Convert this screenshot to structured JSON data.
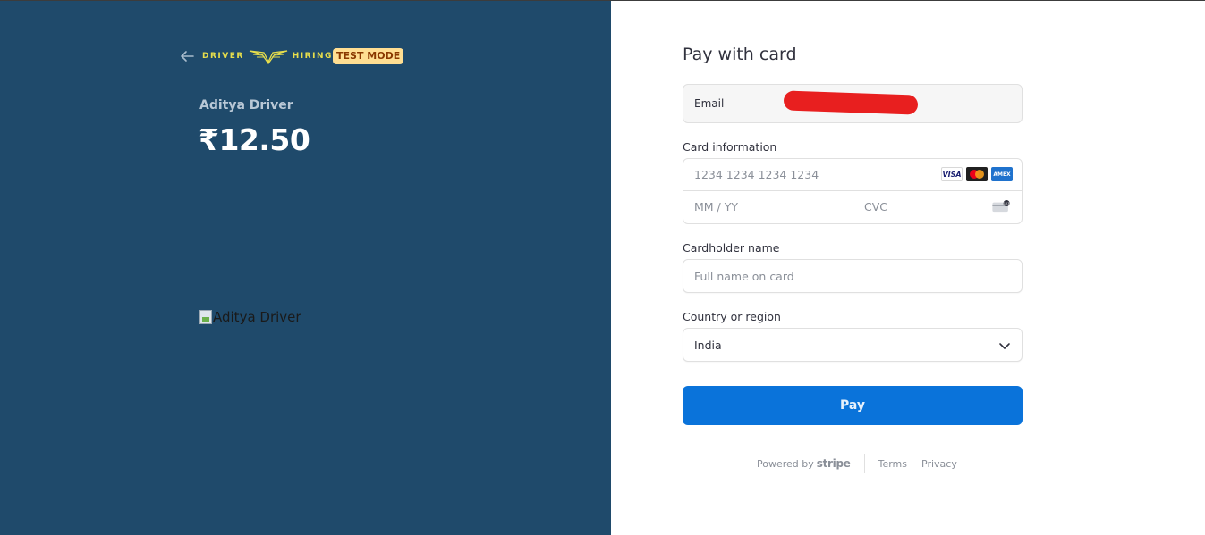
{
  "merchant": {
    "logo_left": "DRIVER",
    "logo_right": "HIRING",
    "test_badge": "TEST MODE",
    "brand_color": "#e7de4c"
  },
  "product": {
    "name": "Aditya Driver",
    "amount": "₹12.50",
    "image_alt": "Aditya Driver"
  },
  "checkout": {
    "title": "Pay with card",
    "email": {
      "label": "Email",
      "value": ""
    },
    "card_info": {
      "label": "Card information",
      "number_placeholder": "1234 1234 1234 1234",
      "expiry_placeholder": "MM / YY",
      "cvc_placeholder": "CVC",
      "brands": [
        "VISA",
        "mastercard",
        "AMEX"
      ]
    },
    "cardholder": {
      "label": "Cardholder name",
      "placeholder": "Full name on card"
    },
    "country": {
      "label": "Country or region",
      "selected": "India"
    },
    "pay_button": "Pay",
    "accent_color": "#0a73da"
  },
  "footer": {
    "powered_by": "Powered by",
    "stripe": "stripe",
    "terms": "Terms",
    "privacy": "Privacy"
  }
}
